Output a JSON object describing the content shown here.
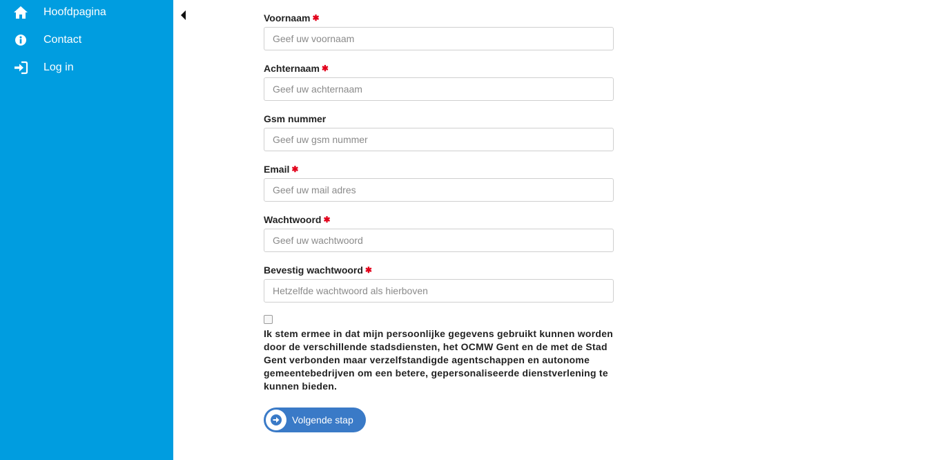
{
  "sidebar": {
    "background": "#009de0",
    "items": [
      {
        "label": "Hoofdpagina",
        "icon": "home-icon"
      },
      {
        "label": "Contact",
        "icon": "info-icon"
      },
      {
        "label": "Log in",
        "icon": "login-icon"
      }
    ]
  },
  "form": {
    "required_marker": "✱",
    "fields": [
      {
        "label": "Voornaam",
        "required": true,
        "placeholder": "Geef uw voornaam",
        "value": ""
      },
      {
        "label": "Achternaam",
        "required": true,
        "placeholder": "Geef uw achternaam",
        "value": ""
      },
      {
        "label": "Gsm nummer",
        "required": false,
        "placeholder": "Geef uw gsm nummer",
        "value": ""
      },
      {
        "label": "Email",
        "required": true,
        "placeholder": "Geef uw mail adres",
        "value": ""
      },
      {
        "label": "Wachtwoord",
        "required": true,
        "placeholder": "Geef uw wachtwoord",
        "value": ""
      },
      {
        "label": "Bevestig wachtwoord",
        "required": true,
        "placeholder": "Hetzelfde wachtwoord als hierboven",
        "value": ""
      }
    ],
    "consent": {
      "checked": false,
      "text": "Ik stem ermee in dat mijn persoonlijke gegevens gebruikt kunnen worden door de verschillende stadsdiensten, het OCMW Gent en de met de Stad Gent verbonden maar verzelfstandigde agentschappen en autonome gemeentebedrijven om een betere, gepersonaliseerde dienstverlening te kunnen bieden."
    },
    "next_button": {
      "label": "Volgende stap",
      "icon": "arrow-circle-right-icon",
      "color": "#3a7ac7"
    }
  },
  "colors": {
    "required": "#e2001a",
    "accent": "#009de0"
  }
}
